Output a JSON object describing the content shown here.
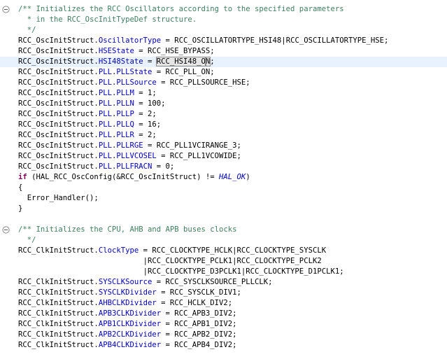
{
  "editor": {
    "highlight_color": "#e8f2fe",
    "comment_color": "#3f7f5f",
    "field_color": "#0000c0",
    "keyword_color": "#7f0055",
    "lines": [
      {
        "parts": [
          {
            "t": "/** Initializes the RCC Oscillators according to the specified parameters",
            "c": "cm"
          }
        ]
      },
      {
        "parts": [
          {
            "t": "  * in the RCC_OscInitTypeDef structure.",
            "c": "cm"
          }
        ]
      },
      {
        "parts": [
          {
            "t": "  */",
            "c": "cm"
          }
        ]
      },
      {
        "parts": [
          {
            "t": "RCC_OscInitStruct.",
            "c": ""
          },
          {
            "t": "OscillatorType",
            "c": "fld"
          },
          {
            "t": " = RCC_OSCILLATORTYPE_HSI48|RCC_OSCILLATORTYPE_HSE;",
            "c": ""
          }
        ]
      },
      {
        "parts": [
          {
            "t": "RCC_OscInitStruct.",
            "c": ""
          },
          {
            "t": "HSEState",
            "c": "fld"
          },
          {
            "t": " = RCC_HSE_BYPASS;",
            "c": ""
          }
        ]
      },
      {
        "current": true,
        "parts": [
          {
            "t": "RCC_OscInitStruct.",
            "c": ""
          },
          {
            "t": "HSI48State",
            "c": "fld"
          },
          {
            "t": " = ",
            "c": ""
          },
          {
            "t": "RCC_HSI48_O",
            "c": "sel"
          },
          {
            "t": "",
            "c": "caret"
          },
          {
            "t": "N",
            "c": "sel"
          },
          {
            "t": ";",
            "c": ""
          }
        ]
      },
      {
        "parts": [
          {
            "t": "RCC_OscInitStruct.",
            "c": ""
          },
          {
            "t": "PLL",
            "c": "fld"
          },
          {
            "t": ".",
            "c": ""
          },
          {
            "t": "PLLState",
            "c": "fld"
          },
          {
            "t": " = RCC_PLL_ON;",
            "c": ""
          }
        ]
      },
      {
        "parts": [
          {
            "t": "RCC_OscInitStruct.",
            "c": ""
          },
          {
            "t": "PLL",
            "c": "fld"
          },
          {
            "t": ".",
            "c": ""
          },
          {
            "t": "PLLSource",
            "c": "fld"
          },
          {
            "t": " = RCC_PLLSOURCE_HSE;",
            "c": ""
          }
        ]
      },
      {
        "parts": [
          {
            "t": "RCC_OscInitStruct.",
            "c": ""
          },
          {
            "t": "PLL",
            "c": "fld"
          },
          {
            "t": ".",
            "c": ""
          },
          {
            "t": "PLLM",
            "c": "fld"
          },
          {
            "t": " = 1;",
            "c": ""
          }
        ]
      },
      {
        "parts": [
          {
            "t": "RCC_OscInitStruct.",
            "c": ""
          },
          {
            "t": "PLL",
            "c": "fld"
          },
          {
            "t": ".",
            "c": ""
          },
          {
            "t": "PLLN",
            "c": "fld"
          },
          {
            "t": " = 100;",
            "c": ""
          }
        ]
      },
      {
        "parts": [
          {
            "t": "RCC_OscInitStruct.",
            "c": ""
          },
          {
            "t": "PLL",
            "c": "fld"
          },
          {
            "t": ".",
            "c": ""
          },
          {
            "t": "PLLP",
            "c": "fld"
          },
          {
            "t": " = 2;",
            "c": ""
          }
        ]
      },
      {
        "parts": [
          {
            "t": "RCC_OscInitStruct.",
            "c": ""
          },
          {
            "t": "PLL",
            "c": "fld"
          },
          {
            "t": ".",
            "c": ""
          },
          {
            "t": "PLLQ",
            "c": "fld"
          },
          {
            "t": " = 16;",
            "c": ""
          }
        ]
      },
      {
        "parts": [
          {
            "t": "RCC_OscInitStruct.",
            "c": ""
          },
          {
            "t": "PLL",
            "c": "fld"
          },
          {
            "t": ".",
            "c": ""
          },
          {
            "t": "PLLR",
            "c": "fld"
          },
          {
            "t": " = 2;",
            "c": ""
          }
        ]
      },
      {
        "parts": [
          {
            "t": "RCC_OscInitStruct.",
            "c": ""
          },
          {
            "t": "PLL",
            "c": "fld"
          },
          {
            "t": ".",
            "c": ""
          },
          {
            "t": "PLLRGE",
            "c": "fld"
          },
          {
            "t": " = RCC_PLL1VCIRANGE_3;",
            "c": ""
          }
        ]
      },
      {
        "parts": [
          {
            "t": "RCC_OscInitStruct.",
            "c": ""
          },
          {
            "t": "PLL",
            "c": "fld"
          },
          {
            "t": ".",
            "c": ""
          },
          {
            "t": "PLLVCOSEL",
            "c": "fld"
          },
          {
            "t": " = RCC_PLL1VCOWIDE;",
            "c": ""
          }
        ]
      },
      {
        "parts": [
          {
            "t": "RCC_OscInitStruct.",
            "c": ""
          },
          {
            "t": "PLL",
            "c": "fld"
          },
          {
            "t": ".",
            "c": ""
          },
          {
            "t": "PLLFRACN",
            "c": "fld"
          },
          {
            "t": " = 0;",
            "c": ""
          }
        ]
      },
      {
        "parts": [
          {
            "t": "if",
            "c": "kw"
          },
          {
            "t": " (HAL_RCC_OscConfig(&RCC_OscInitStruct) != ",
            "c": ""
          },
          {
            "t": "HAL_OK",
            "c": "it"
          },
          {
            "t": ")",
            "c": ""
          }
        ]
      },
      {
        "parts": [
          {
            "t": "{",
            "c": ""
          }
        ]
      },
      {
        "parts": [
          {
            "t": "  Error_Handler();",
            "c": ""
          }
        ]
      },
      {
        "parts": [
          {
            "t": "}",
            "c": ""
          }
        ]
      },
      {
        "parts": []
      },
      {
        "parts": [
          {
            "t": "/** Initializes the CPU, AHB and APB buses clocks",
            "c": "cm"
          }
        ]
      },
      {
        "parts": [
          {
            "t": "  */",
            "c": "cm"
          }
        ]
      },
      {
        "parts": [
          {
            "t": "RCC_ClkInitStruct.",
            "c": ""
          },
          {
            "t": "ClockType",
            "c": "fld"
          },
          {
            "t": " = RCC_CLOCKTYPE_HCLK|RCC_CLOCKTYPE_SYSCLK",
            "c": ""
          }
        ]
      },
      {
        "parts": [
          {
            "t": "                            |RCC_CLOCKTYPE_PCLK1|RCC_CLOCKTYPE_PCLK2",
            "c": ""
          }
        ]
      },
      {
        "parts": [
          {
            "t": "                            |RCC_CLOCKTYPE_D3PCLK1|RCC_CLOCKTYPE_D1PCLK1;",
            "c": ""
          }
        ]
      },
      {
        "parts": [
          {
            "t": "RCC_ClkInitStruct.",
            "c": ""
          },
          {
            "t": "SYSCLKSource",
            "c": "fld"
          },
          {
            "t": " = RCC_SYSCLKSOURCE_PLLCLK;",
            "c": ""
          }
        ]
      },
      {
        "parts": [
          {
            "t": "RCC_ClkInitStruct.",
            "c": ""
          },
          {
            "t": "SYSCLKDivider",
            "c": "fld"
          },
          {
            "t": " = RCC_SYSCLK_DIV1;",
            "c": ""
          }
        ]
      },
      {
        "parts": [
          {
            "t": "RCC_ClkInitStruct.",
            "c": ""
          },
          {
            "t": "AHBCLKDivider",
            "c": "fld"
          },
          {
            "t": " = RCC_HCLK_DIV2;",
            "c": ""
          }
        ]
      },
      {
        "parts": [
          {
            "t": "RCC_ClkInitStruct.",
            "c": ""
          },
          {
            "t": "APB3CLKDivider",
            "c": "fld"
          },
          {
            "t": " = RCC_APB3_DIV2;",
            "c": ""
          }
        ]
      },
      {
        "parts": [
          {
            "t": "RCC_ClkInitStruct.",
            "c": ""
          },
          {
            "t": "APB1CLKDivider",
            "c": "fld"
          },
          {
            "t": " = RCC_APB1_DIV2;",
            "c": ""
          }
        ]
      },
      {
        "parts": [
          {
            "t": "RCC_ClkInitStruct.",
            "c": ""
          },
          {
            "t": "APB2CLKDivider",
            "c": "fld"
          },
          {
            "t": " = RCC_APB2_DIV2;",
            "c": ""
          }
        ]
      },
      {
        "parts": [
          {
            "t": "RCC_ClkInitStruct.",
            "c": ""
          },
          {
            "t": "APB4CLKDivider",
            "c": "fld"
          },
          {
            "t": " = RCC_APB4_DIV2;",
            "c": ""
          }
        ]
      }
    ],
    "folds": [
      {
        "line": 0,
        "icon": "fold-collapse-icon"
      },
      {
        "line": 21,
        "icon": "fold-collapse-icon"
      }
    ]
  }
}
